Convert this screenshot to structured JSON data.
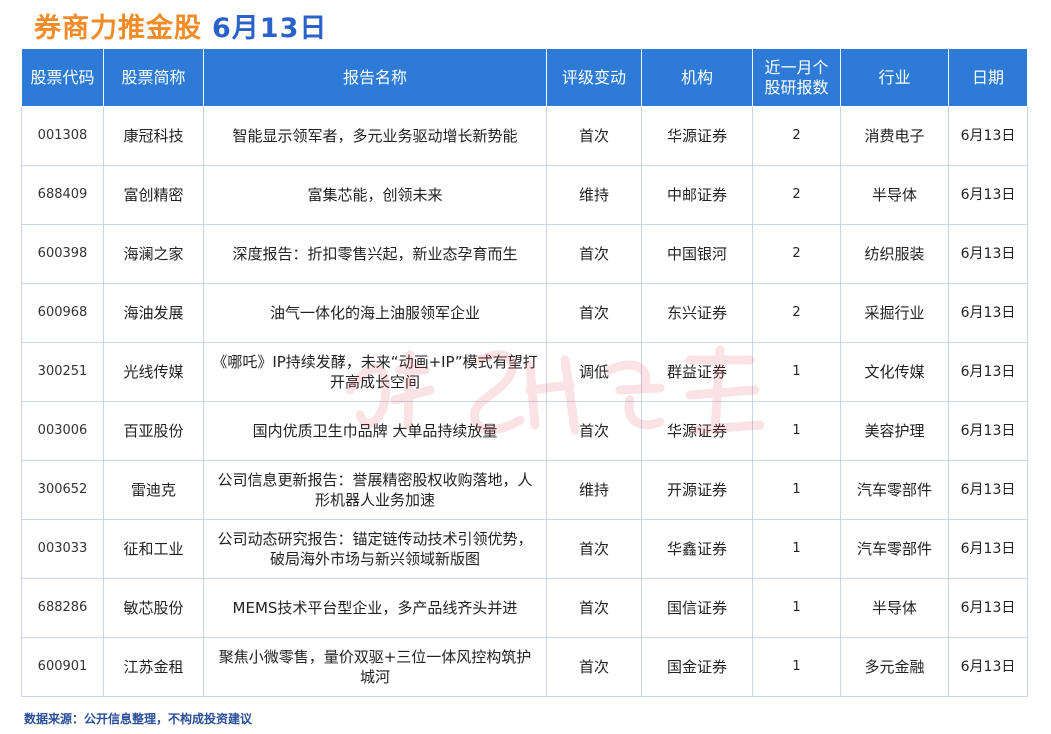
{
  "title": {
    "main": "券商力推金股",
    "date": "6月13日"
  },
  "colors": {
    "title_orange": "#f28c28",
    "title_blue": "#2a62c9",
    "header_bg": "#2d7bd6",
    "footer_text": "#2a4f9a"
  },
  "table": {
    "headers": [
      "股票代码",
      "股票简称",
      "报告名称",
      "评级变动",
      "机构",
      "近一月个股研报数",
      "行业",
      "日期"
    ],
    "rows": [
      {
        "code": "001308",
        "name": "康冠科技",
        "report": "智能显示领军者，多元业务驱动增长新势能",
        "rating": "首次",
        "institution": "华源证券",
        "count": "2",
        "industry": "消费电子",
        "date": "6月13日"
      },
      {
        "code": "688409",
        "name": "富创精密",
        "report": "富集芯能，创领未来",
        "rating": "维持",
        "institution": "中邮证券",
        "count": "2",
        "industry": "半导体",
        "date": "6月13日"
      },
      {
        "code": "600398",
        "name": "海澜之家",
        "report": "深度报告：折扣零售兴起，新业态孕育而生",
        "rating": "首次",
        "institution": "中国银河",
        "count": "2",
        "industry": "纺织服装",
        "date": "6月13日"
      },
      {
        "code": "600968",
        "name": "海油发展",
        "report": "油气一体化的海上油服领军企业",
        "rating": "首次",
        "institution": "东兴证券",
        "count": "2",
        "industry": "采掘行业",
        "date": "6月13日"
      },
      {
        "code": "300251",
        "name": "光线传媒",
        "report": "《哪吒》IP持续发酵，未来“动画+IP”模式有望打开高成长空间",
        "rating": "调低",
        "institution": "群益证券",
        "count": "1",
        "industry": "文化传媒",
        "date": "6月13日"
      },
      {
        "code": "003006",
        "name": "百亚股份",
        "report": "国内优质卫生巾品牌 大单品持续放量",
        "rating": "首次",
        "institution": "华源证券",
        "count": "1",
        "industry": "美容护理",
        "date": "6月13日"
      },
      {
        "code": "300652",
        "name": "雷迪克",
        "report": "公司信息更新报告：誉展精密股权收购落地，人形机器人业务加速",
        "rating": "维持",
        "institution": "开源证券",
        "count": "1",
        "industry": "汽车零部件",
        "date": "6月13日"
      },
      {
        "code": "003033",
        "name": "征和工业",
        "report": "公司动态研究报告：锚定链传动技术引领优势，破局海外市场与新兴领域新版图",
        "rating": "首次",
        "institution": "华鑫证券",
        "count": "1",
        "industry": "汽车零部件",
        "date": "6月13日"
      },
      {
        "code": "688286",
        "name": "敏芯股份",
        "report": "MEMS技术平台型企业，多产品线齐头并进",
        "rating": "首次",
        "institution": "国信证券",
        "count": "1",
        "industry": "半导体",
        "date": "6月13日"
      },
      {
        "code": "600901",
        "name": "江苏金租",
        "report": "聚焦小微零售，量价双驱+三位一体风控构筑护城河",
        "rating": "首次",
        "institution": "国金证券",
        "count": "1",
        "industry": "多元金融",
        "date": "6月13日"
      }
    ]
  },
  "footer": "数据来源：公开信息整理，不构成投资建议"
}
